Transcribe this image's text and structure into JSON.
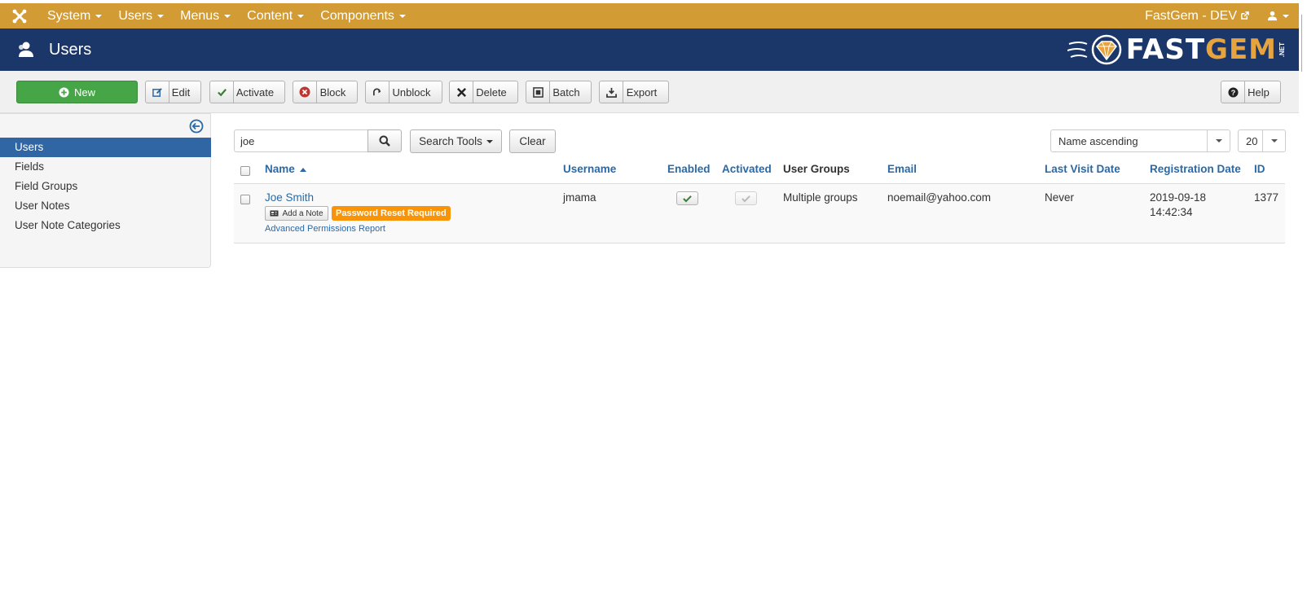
{
  "topbar": {
    "menus": [
      "System",
      "Users",
      "Menus",
      "Content",
      "Components"
    ],
    "site_link": "FastGem - DEV",
    "icons": {
      "brand": "joomla-icon",
      "external": "external-link-icon",
      "user": "user-icon"
    }
  },
  "header": {
    "title": "Users",
    "logo_main": "FAST",
    "logo_accent": "GEM",
    "logo_suffix": ".NET"
  },
  "toolbar": {
    "new": "New",
    "edit": "Edit",
    "activate": "Activate",
    "block": "Block",
    "unblock": "Unblock",
    "delete": "Delete",
    "batch": "Batch",
    "export": "Export",
    "help": "Help"
  },
  "sidebar": {
    "items": [
      {
        "label": "Users",
        "active": true
      },
      {
        "label": "Fields"
      },
      {
        "label": "Field Groups"
      },
      {
        "label": "User Notes"
      },
      {
        "label": "User Note Categories"
      }
    ]
  },
  "filters": {
    "search_value": "joe",
    "search_tools": "Search Tools",
    "clear": "Clear",
    "ordering": "Name ascending",
    "limit": "20"
  },
  "table": {
    "columns": {
      "name": "Name",
      "username": "Username",
      "enabled": "Enabled",
      "activated": "Activated",
      "user_groups": "User Groups",
      "email": "Email",
      "last_visit": "Last Visit Date",
      "registration": "Registration Date",
      "id": "ID"
    },
    "rows": [
      {
        "name": "Joe Smith",
        "add_note": "Add a Note",
        "badge": "Password Reset Required",
        "permissions_link": "Advanced Permissions Report",
        "username": "jmama",
        "user_groups": "Multiple groups",
        "email": "noemail@yahoo.com",
        "last_visit": "Never",
        "registration_date": "2019-09-18",
        "registration_time": "14:42:34",
        "id": "1377"
      }
    ]
  },
  "colors": {
    "topbar": "#d39b33",
    "header": "#1b3769",
    "new_button": "#46a546",
    "sidebar_active": "#2f66a3",
    "link": "#2a69a6",
    "warning_badge": "#f89406"
  }
}
